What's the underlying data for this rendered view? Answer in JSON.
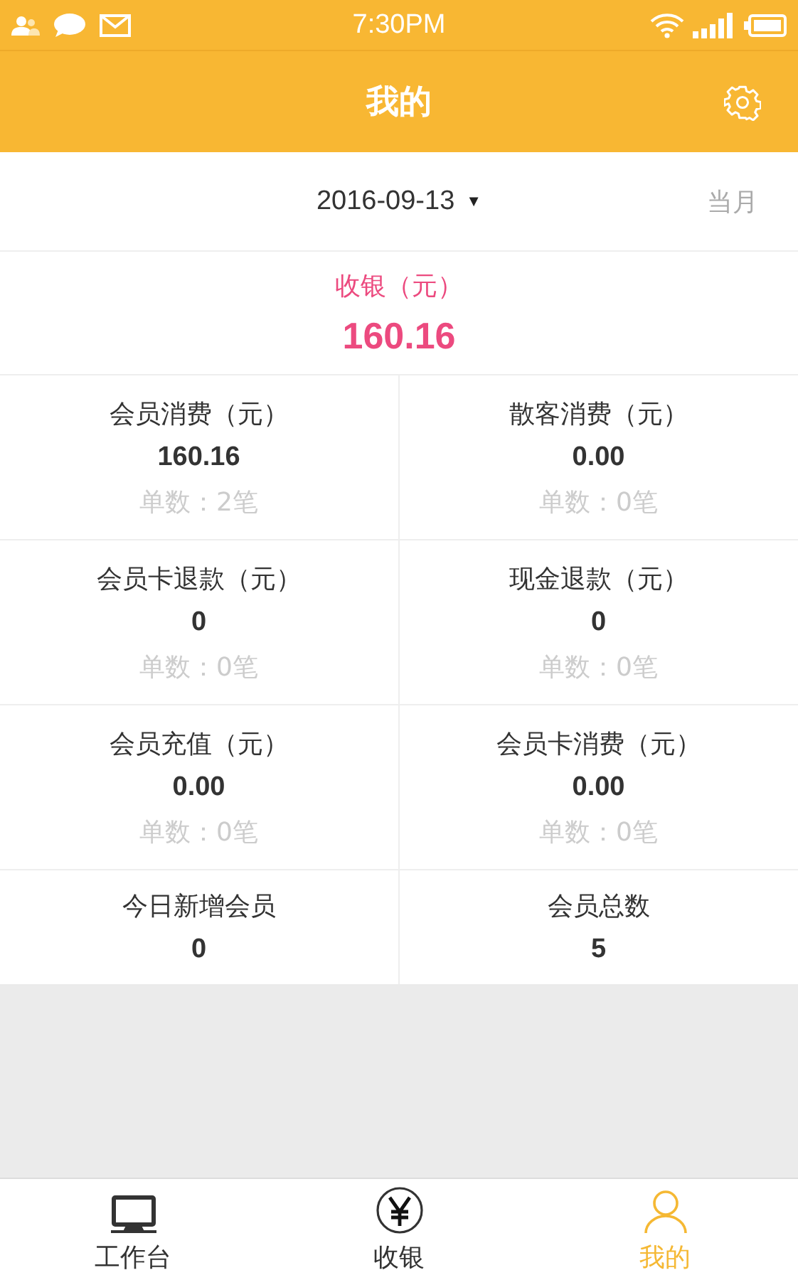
{
  "status_bar": {
    "time": "7:30PM"
  },
  "header": {
    "title": "我的"
  },
  "date_bar": {
    "date": "2016-09-13",
    "dropdown_icon": "▼",
    "period": "当月"
  },
  "summary": {
    "label": "收银（元）",
    "value": "160.16"
  },
  "stats": [
    {
      "label": "会员消费（元）",
      "value": "160.16",
      "count": "单数：2笔"
    },
    {
      "label": "散客消费（元）",
      "value": "0.00",
      "count": "单数：0笔"
    },
    {
      "label": "会员卡退款（元）",
      "value": "0",
      "count": "单数：0笔"
    },
    {
      "label": "现金退款（元）",
      "value": "0",
      "count": "单数：0笔"
    },
    {
      "label": "会员充值（元）",
      "value": "0.00",
      "count": "单数：0笔"
    },
    {
      "label": "会员卡消费（元）",
      "value": "0.00",
      "count": "单数：0笔"
    },
    {
      "label": "今日新增会员",
      "value": "0"
    },
    {
      "label": "会员总数",
      "value": "5"
    }
  ],
  "tabs": [
    {
      "label": "工作台",
      "kind": "desk",
      "selected": false
    },
    {
      "label": "收银",
      "kind": "cash",
      "selected": false
    },
    {
      "label": "我的",
      "kind": "person",
      "selected": true
    }
  ]
}
